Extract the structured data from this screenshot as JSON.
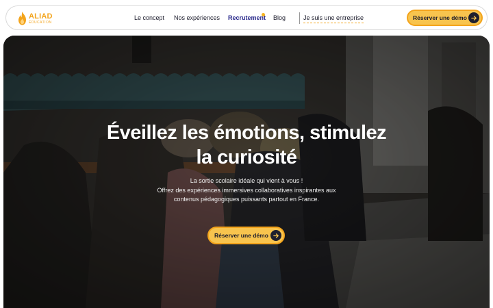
{
  "brand": {
    "name": "ALIAD",
    "tagline": "ÉDUCATION",
    "color": "#f3a41c"
  },
  "nav": {
    "links": [
      {
        "label": "Le concept"
      },
      {
        "label": "Nos expériences"
      },
      {
        "label": "Recrutement",
        "active": true,
        "badge": "notification-dot"
      },
      {
        "label": "Blog"
      }
    ],
    "enterprise_label": "Je suis une entreprise",
    "cta_label": "Réserver une démo",
    "cta_icon": "arrow-right-icon"
  },
  "hero": {
    "title_line1": "Éveillez les émotions, stimulez",
    "title_line2": "la curiosité",
    "subtitle_line1": "La sortie scolaire idéale qui vient à vous !",
    "subtitle_line2": "Offrez des expériences immersives collaboratives inspirantes aux",
    "subtitle_line3": "contenus pédagogiques puissants partout en France.",
    "cta_label": "Réserver une démo",
    "cta_icon": "arrow-right-icon",
    "background": "school-coat-rack-photo"
  },
  "colors": {
    "accent": "#f8c44e",
    "accent_border": "#f3a41c",
    "dark": "#1f1f2e",
    "active_link": "#2a2a8c"
  }
}
